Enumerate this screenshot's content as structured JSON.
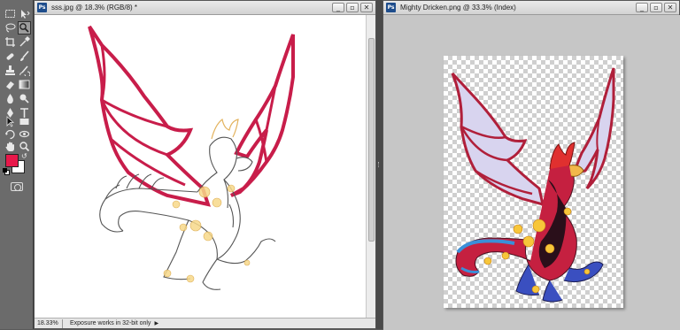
{
  "tools_panel": {
    "tools": [
      {
        "name": "rectangular-marquee-icon",
        "glyph": "⬚"
      },
      {
        "name": "move-icon",
        "glyph": "✥"
      },
      {
        "name": "lasso-icon",
        "glyph": "ᔓ"
      },
      {
        "name": "magic-wand-icon",
        "glyph": "⚲"
      },
      {
        "name": "crop-icon",
        "glyph": "⌗"
      },
      {
        "name": "eyedropper-icon",
        "glyph": "✎"
      },
      {
        "name": "healing-brush-icon",
        "glyph": "✚"
      },
      {
        "name": "brush-icon",
        "glyph": "🖌"
      },
      {
        "name": "clone-stamp-icon",
        "glyph": "⊥"
      },
      {
        "name": "history-brush-icon",
        "glyph": "↺"
      },
      {
        "name": "eraser-icon",
        "glyph": "▱"
      },
      {
        "name": "gradient-icon",
        "glyph": "▦"
      },
      {
        "name": "blur-icon",
        "glyph": "💧"
      },
      {
        "name": "dodge-icon",
        "glyph": "●"
      },
      {
        "name": "pen-icon",
        "glyph": "✒"
      },
      {
        "name": "type-icon",
        "glyph": "T"
      },
      {
        "name": "path-selection-icon",
        "glyph": "➤"
      },
      {
        "name": "rectangle-shape-icon",
        "glyph": "▭"
      },
      {
        "name": "3d-rotate-icon",
        "glyph": "⟲"
      },
      {
        "name": "3d-orbit-icon",
        "glyph": "⟳"
      },
      {
        "name": "hand-icon",
        "glyph": "✋"
      },
      {
        "name": "zoom-icon",
        "glyph": "🔍"
      }
    ],
    "foreground_color": "#e8184a",
    "background_color": "#ffffff"
  },
  "doc1": {
    "title": "sss.jpg @ 18.3% (RGB/8) *",
    "zoom": "18.33%",
    "status": "Exposure works in 32-bit only"
  },
  "doc2": {
    "title": "Mighty Dricken.png @ 33.3% (Index)"
  },
  "window_controls": {
    "minimize": "_",
    "maximize": "▫",
    "close": "✕"
  }
}
